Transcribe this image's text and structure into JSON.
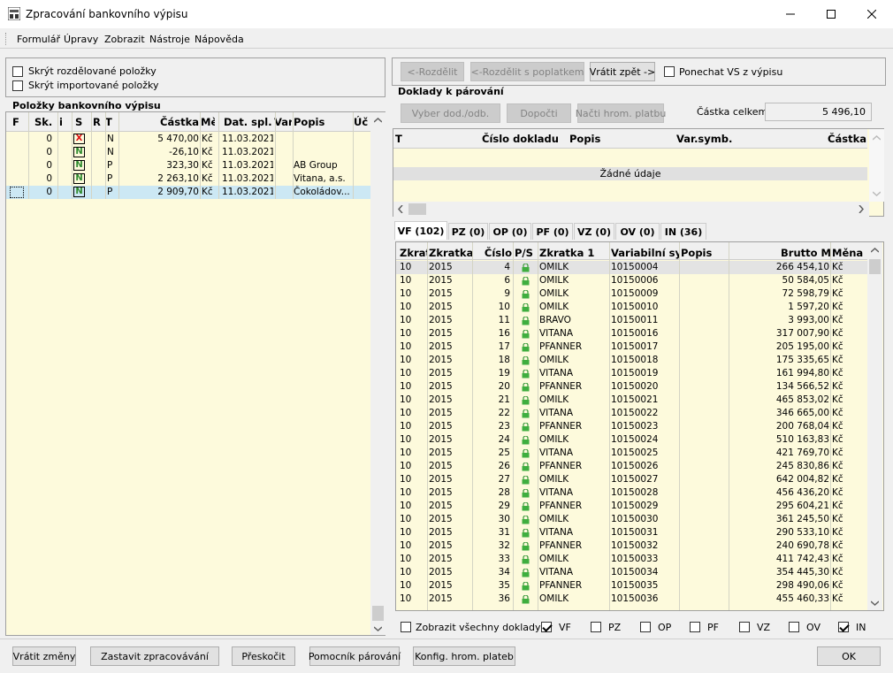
{
  "window": {
    "title": "Zpracování bankovního výpisu",
    "icon": "bank-app-icon"
  },
  "menu": [
    "Formulář",
    "Úpravy",
    "Zobrazit",
    "Nástroje",
    "Nápověda"
  ],
  "options": {
    "hide_split": "Skrýt rozdělované položky",
    "hide_imported": "Skrýt importované položky"
  },
  "items_panel": {
    "title": "Položky bankovního výpisu",
    "columns": [
      "F",
      "Sk.",
      "i",
      "S",
      "R",
      "T",
      "Částka",
      "Mě",
      "Dat. spl.",
      "Var",
      "Popis",
      "Úč"
    ],
    "rows": [
      {
        "sk": "0",
        "s": "X",
        "t": "N",
        "castka": "5 470,00",
        "mena": "Kč",
        "datum": "11.03.2021",
        "popis": ""
      },
      {
        "sk": "0",
        "s": "N",
        "t": "N",
        "castka": "-26,10",
        "mena": "Kč",
        "datum": "11.03.2021",
        "popis": ""
      },
      {
        "sk": "0",
        "s": "N",
        "t": "P",
        "castka": "323,30",
        "mena": "Kč",
        "datum": "11.03.2021",
        "popis": "AB Group"
      },
      {
        "sk": "0",
        "s": "N",
        "t": "P",
        "castka": "2 263,10",
        "mena": "Kč",
        "datum": "11.03.2021",
        "popis": "Vitana, a.s."
      },
      {
        "sk": "0",
        "s": "N",
        "t": "P",
        "castka": "2 909,70",
        "mena": "Kč",
        "datum": "11.03.2021",
        "popis": "Čokoládov..."
      }
    ]
  },
  "top_buttons": {
    "split": "<-Rozdělit",
    "split_fee": "<-Rozdělit s poplatkem",
    "revert": "Vrátit zpět ->",
    "keep_vs": "Ponechat VS z výpisu"
  },
  "docs_panel": {
    "title": "Doklady k párování",
    "select_btn": "Vyber dod./odb.",
    "complete_btn": "Dopočti",
    "load_btn": "Načti hrom. platbu",
    "total_label": "Částka celkem:",
    "total_value": "5 496,10",
    "columns": [
      "T",
      "Číslo dokladu",
      "Popis",
      "Var.symb.",
      "Částka"
    ],
    "empty": "Žádné údaje"
  },
  "tabs": [
    "VF (102)",
    "PZ (0)",
    "OP (0)",
    "PF (0)",
    "VZ (0)",
    "OV (0)",
    "IN (36)"
  ],
  "invoices": {
    "columns": [
      "Zkrat",
      "Zkratka",
      "Číslo",
      "P/S",
      "Zkratka 1",
      "Variabilní sy",
      "Popis",
      "Brutto M",
      "Měna"
    ],
    "rows": [
      [
        "10",
        "2015",
        "4",
        "OMILK",
        "10150004",
        "266 454,10",
        "Kč"
      ],
      [
        "10",
        "2015",
        "6",
        "OMILK",
        "10150006",
        "50 584,05",
        "Kč"
      ],
      [
        "10",
        "2015",
        "9",
        "OMILK",
        "10150009",
        "72 598,79",
        "Kč"
      ],
      [
        "10",
        "2015",
        "10",
        "OMILK",
        "10150010",
        "1 597,20",
        "Kč"
      ],
      [
        "10",
        "2015",
        "11",
        "BRAVO",
        "10150011",
        "3 993,00",
        "Kč"
      ],
      [
        "10",
        "2015",
        "16",
        "VITANA",
        "10150016",
        "317 007,90",
        "Kč"
      ],
      [
        "10",
        "2015",
        "17",
        "PFANNER",
        "10150017",
        "205 195,00",
        "Kč"
      ],
      [
        "10",
        "2015",
        "18",
        "OMILK",
        "10150018",
        "175 335,65",
        "Kč"
      ],
      [
        "10",
        "2015",
        "19",
        "VITANA",
        "10150019",
        "161 994,80",
        "Kč"
      ],
      [
        "10",
        "2015",
        "20",
        "PFANNER",
        "10150020",
        "134 566,52",
        "Kč"
      ],
      [
        "10",
        "2015",
        "21",
        "OMILK",
        "10150021",
        "465 853,02",
        "Kč"
      ],
      [
        "10",
        "2015",
        "22",
        "VITANA",
        "10150022",
        "346 665,00",
        "Kč"
      ],
      [
        "10",
        "2015",
        "23",
        "PFANNER",
        "10150023",
        "200 768,04",
        "Kč"
      ],
      [
        "10",
        "2015",
        "24",
        "OMILK",
        "10150024",
        "510 163,83",
        "Kč"
      ],
      [
        "10",
        "2015",
        "25",
        "VITANA",
        "10150025",
        "421 769,70",
        "Kč"
      ],
      [
        "10",
        "2015",
        "26",
        "PFANNER",
        "10150026",
        "245 830,86",
        "Kč"
      ],
      [
        "10",
        "2015",
        "27",
        "OMILK",
        "10150027",
        "642 004,82",
        "Kč"
      ],
      [
        "10",
        "2015",
        "28",
        "VITANA",
        "10150028",
        "456 436,20",
        "Kč"
      ],
      [
        "10",
        "2015",
        "29",
        "PFANNER",
        "10150029",
        "295 604,21",
        "Kč"
      ],
      [
        "10",
        "2015",
        "30",
        "OMILK",
        "10150030",
        "361 245,50",
        "Kč"
      ],
      [
        "10",
        "2015",
        "31",
        "VITANA",
        "10150031",
        "290 533,10",
        "Kč"
      ],
      [
        "10",
        "2015",
        "32",
        "PFANNER",
        "10150032",
        "240 690,78",
        "Kč"
      ],
      [
        "10",
        "2015",
        "33",
        "OMILK",
        "10150033",
        "411 742,43",
        "Kč"
      ],
      [
        "10",
        "2015",
        "34",
        "VITANA",
        "10150034",
        "354 445,30",
        "Kč"
      ],
      [
        "10",
        "2015",
        "35",
        "PFANNER",
        "10150035",
        "298 490,06",
        "Kč"
      ],
      [
        "10",
        "2015",
        "36",
        "OMILK",
        "10150036",
        "455 460,33",
        "Kč"
      ]
    ]
  },
  "filters": {
    "show_all": "Zobrazit všechny doklady",
    "items": [
      {
        "label": "VF",
        "checked": true
      },
      {
        "label": "PZ",
        "checked": false
      },
      {
        "label": "OP",
        "checked": false
      },
      {
        "label": "PF",
        "checked": false
      },
      {
        "label": "VZ",
        "checked": false
      },
      {
        "label": "OV",
        "checked": false
      },
      {
        "label": "IN",
        "checked": true
      }
    ]
  },
  "bottom_buttons": {
    "revert_changes": "Vrátit změny",
    "stop": "Zastavit zpracovávání",
    "skip": "Přeskočit",
    "helper": "Pomocník párování",
    "config": "Konfig. hrom. plateb",
    "ok": "OK"
  },
  "colors": {
    "grid_bg": "#fdfadc",
    "selected_row": "#cce8f4",
    "badge_green": "#2e8b2e",
    "badge_red": "#e01010"
  }
}
